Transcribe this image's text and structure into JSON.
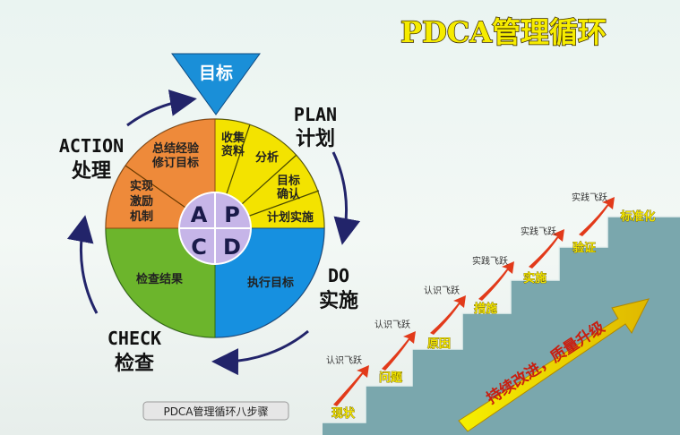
{
  "title": "PDCA管理循环",
  "wheel": {
    "goal": "目标",
    "letters": {
      "p": "P",
      "a": "A",
      "c": "C",
      "d": "D"
    },
    "plan_label": "PLAN",
    "plan_cn": "计划",
    "do_label": "DO",
    "do_cn": "实施",
    "check_label": "CHECK",
    "check_cn": "检查",
    "action_label": "ACTION",
    "action_cn": "处理",
    "segments": {
      "collect_1": "收集",
      "collect_2": "资料",
      "analyze": "分析",
      "goal_confirm_1": "目标",
      "goal_confirm_2": "确认",
      "plan_impl": "计划实施",
      "execute": "执行目标",
      "check_result": "检查结果",
      "incentive_1": "实现",
      "incentive_2": "激励",
      "incentive_3": "机制",
      "summary_1": "总结经验",
      "summary_2": "修订目标"
    },
    "caption": "PDCA管理循环八步骤"
  },
  "stairs": {
    "steps": [
      "现状",
      "问题",
      "原因",
      "措施",
      "实施",
      "验证",
      "标准化"
    ],
    "step_labels": [
      "认识飞跃",
      "认识飞跃",
      "认识飞跃",
      "实践飞跃",
      "实践飞跃",
      "实践飞跃"
    ],
    "slogan": "持续改进，质量升级"
  },
  "colors": {
    "plan": "#f3e300",
    "do": "#1690e0",
    "check": "#6cb52c",
    "action": "#ee8a3a",
    "center": "#c6b5e8",
    "goal": "#1a8fd8",
    "stairs": "#7aa7ad",
    "step_text": "#f0e300",
    "arrow": "#e23a1a"
  }
}
